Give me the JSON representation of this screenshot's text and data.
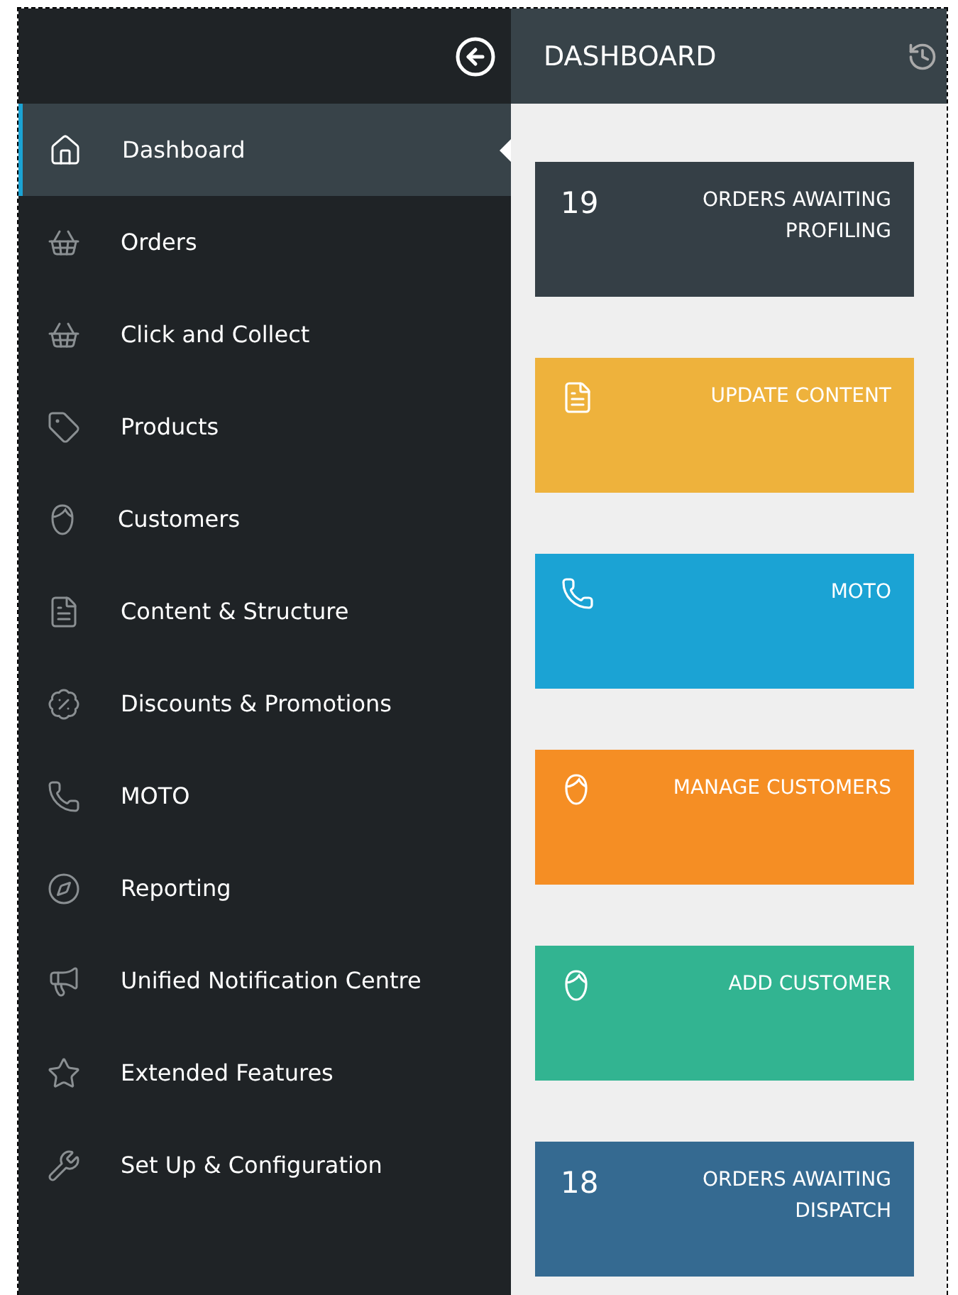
{
  "sidebar": {
    "items": [
      {
        "label": "Dashboard",
        "selected": true
      },
      {
        "label": "Orders",
        "selected": false
      },
      {
        "label": "Click and Collect",
        "selected": false
      },
      {
        "label": "Products",
        "selected": false
      },
      {
        "label": "Customers",
        "selected": false
      },
      {
        "label": "Content & Structure",
        "selected": false
      },
      {
        "label": "Discounts & Promotions",
        "selected": false
      },
      {
        "label": "MOTO",
        "selected": false
      },
      {
        "label": "Reporting",
        "selected": false
      },
      {
        "label": "Unified Notification Centre",
        "selected": false
      },
      {
        "label": "Extended Features",
        "selected": false
      },
      {
        "label": "Set Up & Configuration",
        "selected": false
      }
    ]
  },
  "main": {
    "title": "DASHBOARD",
    "cards": [
      {
        "kind": "count",
        "count": "19",
        "label": "ORDERS AWAITING PROFILING",
        "color": "#353f46"
      },
      {
        "kind": "icon",
        "label": "UPDATE CONTENT",
        "color": "#eeb23c"
      },
      {
        "kind": "icon",
        "label": "MOTO",
        "color": "#1ba3d4"
      },
      {
        "kind": "icon",
        "label": "MANAGE CUSTOMERS",
        "color": "#f58e24"
      },
      {
        "kind": "icon",
        "label": "ADD CUSTOMER",
        "color": "#32b491"
      },
      {
        "kind": "count",
        "count": "18",
        "label": "ORDERS AWAITING DISPATCH",
        "color": "#356a91"
      }
    ]
  }
}
